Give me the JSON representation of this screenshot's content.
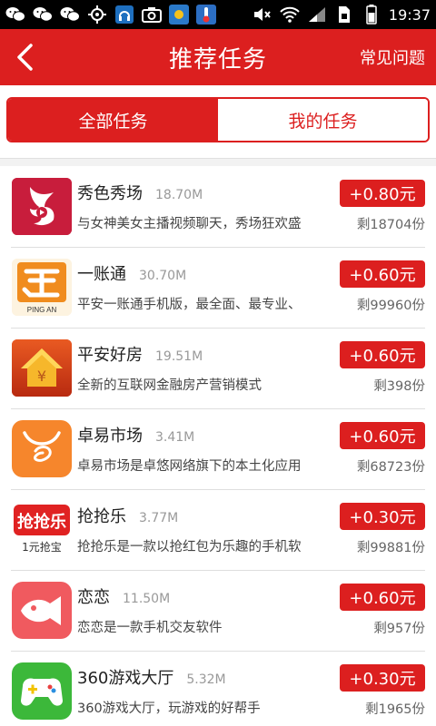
{
  "status": {
    "time": "19:37",
    "colors": {
      "bg": "#000000",
      "fg": "#ffffff"
    }
  },
  "header": {
    "title": "推荐任务",
    "faq_label": "常见问题",
    "accent": "#dc1f1f"
  },
  "tabs": [
    {
      "label": "全部任务",
      "active": true
    },
    {
      "label": "我的任务",
      "active": false
    }
  ],
  "tasks": [
    {
      "name": "秀色秀场",
      "size": "18.70M",
      "desc": "与女神美女主播视频聊天，秀场狂欢盛",
      "reward": "+0.80元",
      "remain": "剩18704份",
      "icon": "xiuse-icon"
    },
    {
      "name": "一账通",
      "size": "30.70M",
      "desc": "平安一账通手机版，最全面、最专业、",
      "reward": "+0.60元",
      "remain": "剩99960份",
      "icon": "yizhangtong-icon",
      "icon_text": "PING AN"
    },
    {
      "name": "平安好房",
      "size": "19.51M",
      "desc": "全新的互联网金融房产营销模式",
      "reward": "+0.60元",
      "remain": "剩398份",
      "icon": "haofang-icon"
    },
    {
      "name": "卓易市场",
      "size": "3.41M",
      "desc": "卓易市场是卓悠网络旗下的本土化应用",
      "reward": "+0.60元",
      "remain": "剩68723份",
      "icon": "zhuoyi-icon"
    },
    {
      "name": "抢抢乐",
      "size": "3.77M",
      "desc": "抢抢乐是一款以抢红包为乐趣的手机软",
      "reward": "+0.30元",
      "remain": "剩99881份",
      "icon": "qiangqiangle-icon",
      "icon_text": "抢抢乐",
      "icon_subtext": "1元抢宝"
    },
    {
      "name": "恋恋",
      "size": "11.50M",
      "desc": "恋恋是一款手机交友软件",
      "reward": "+0.60元",
      "remain": "剩957份",
      "icon": "lianlian-icon"
    },
    {
      "name": "360游戏大厅",
      "size": "5.32M",
      "desc": "360游戏大厅，玩游戏的好帮手",
      "reward": "+0.30元",
      "remain": "剩1965份",
      "icon": "game360-icon"
    }
  ]
}
